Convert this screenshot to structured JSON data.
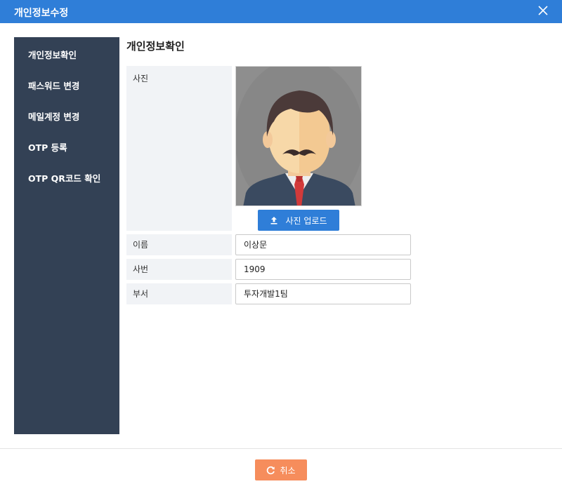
{
  "dialog": {
    "title": "개인정보수정"
  },
  "sidebar": {
    "items": [
      {
        "label": "개인정보확인"
      },
      {
        "label": "패스워드 변경"
      },
      {
        "label": "메일계정 변경"
      },
      {
        "label": "OTP 등록"
      },
      {
        "label": "OTP QR코드 확인"
      }
    ]
  },
  "main": {
    "section_title": "개인정보확인",
    "photo_label": "사진",
    "upload_button": "사진 업로드",
    "fields": [
      {
        "label": "이름",
        "value": "이상문"
      },
      {
        "label": "사번",
        "value": "1909"
      },
      {
        "label": "부서",
        "value": "투자개발1팀"
      }
    ]
  },
  "footer": {
    "cancel_button": "취소"
  }
}
